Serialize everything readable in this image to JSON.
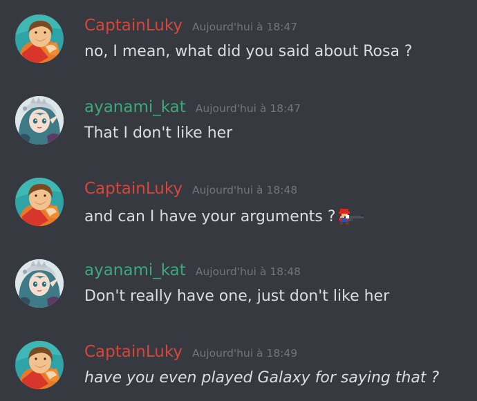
{
  "messages": [
    {
      "author": "CaptainLuky",
      "author_color": "#d8463a",
      "timestamp": "Aujourd'hui à 18:47",
      "text": "no, I mean, what did you said about Rosa ?",
      "avatar": "captainluky-avatar"
    },
    {
      "author": "ayanami_kat",
      "author_color": "#3ea97a",
      "timestamp": "Aujourd'hui à 18:47",
      "text": "That I don't like her",
      "avatar": "ayanami-kat-avatar"
    },
    {
      "author": "CaptainLuky",
      "author_color": "#d8463a",
      "timestamp": "Aujourd'hui à 18:48",
      "text": "and can I have your arguments ?",
      "emoji": "mario-gun-emoji",
      "avatar": "captainluky-avatar"
    },
    {
      "author": "ayanami_kat",
      "author_color": "#3ea97a",
      "timestamp": "Aujourd'hui à 18:48",
      "text": "Don't really have one, just don't like her",
      "avatar": "ayanami-kat-avatar"
    },
    {
      "author": "CaptainLuky",
      "author_color": "#d8463a",
      "timestamp": "Aujourd'hui à 18:49",
      "text": "have you even played Galaxy for saying that ?",
      "style": "italic",
      "avatar": "captainluky-avatar"
    }
  ],
  "theme": {
    "background": "#36393f",
    "message_text": "#dcddde",
    "timestamp_text": "#72767d"
  }
}
